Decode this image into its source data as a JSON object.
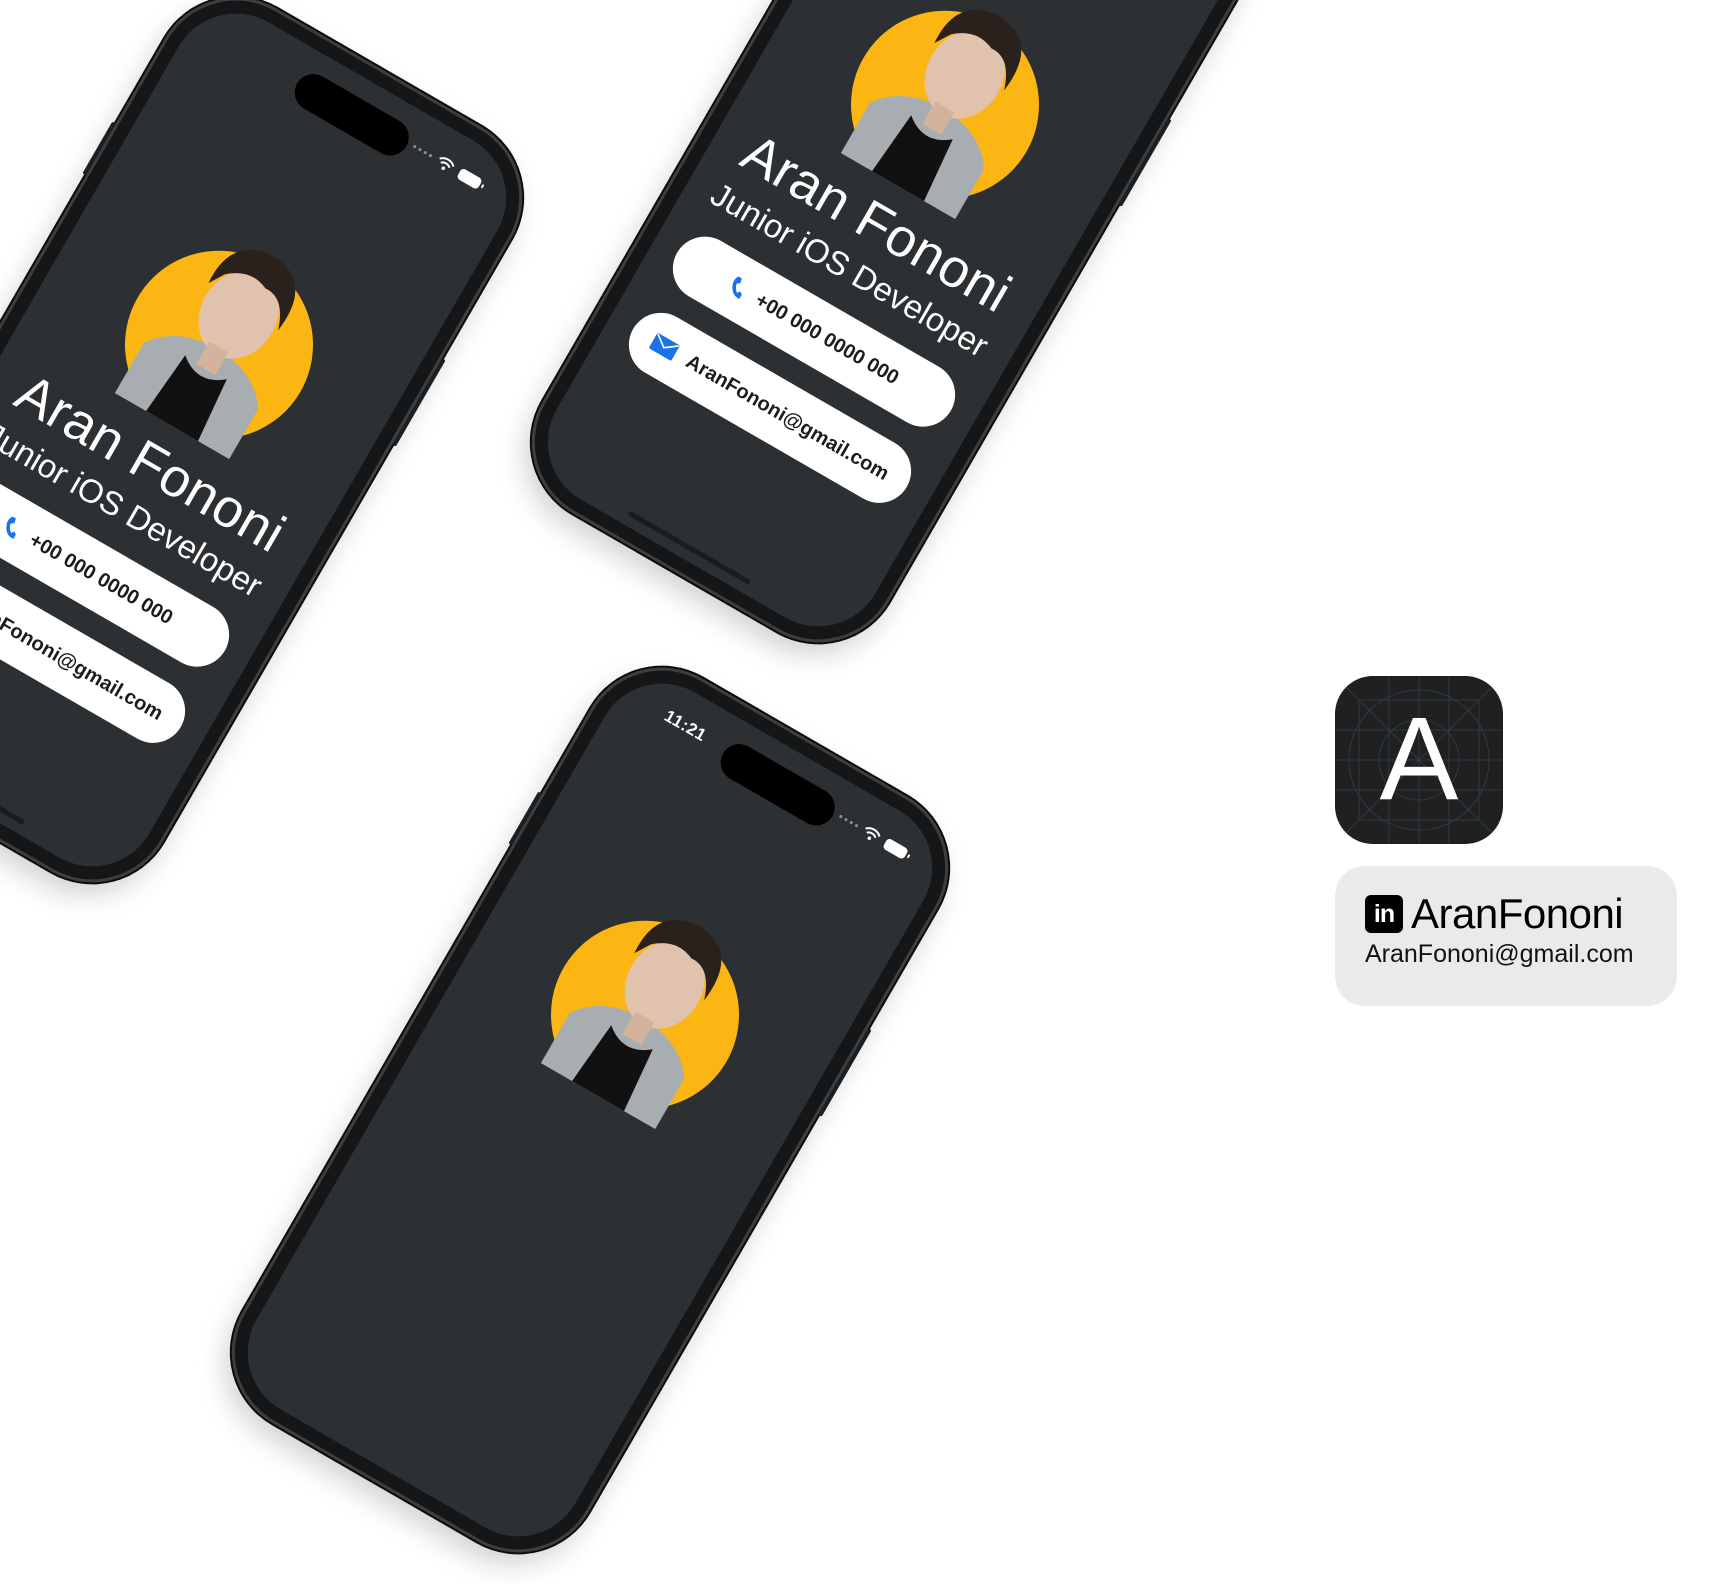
{
  "profile": {
    "name": "Aran Fononi",
    "role": "Junior iOS Developer",
    "phone": "+00 000 0000 000",
    "email": "AranFononi@gmail.com"
  },
  "status_bar": {
    "time": "11:21"
  },
  "app_icon": {
    "letter": "A"
  },
  "linkedin_card": {
    "logo_text": "in",
    "handle": "AranFononi",
    "email": "AranFononi@gmail.com"
  },
  "icons": {
    "phone": "phone-icon",
    "mail": "mail-icon",
    "wifi": "wifi-icon",
    "battery": "battery-icon",
    "signal": "signal-icon",
    "linkedin": "linkedin-icon"
  },
  "colors": {
    "screen": "#2c3033",
    "avatar_bg": "#fbb614",
    "accent_icon": "#1a73e8",
    "card_bg": "#e8eaec"
  }
}
